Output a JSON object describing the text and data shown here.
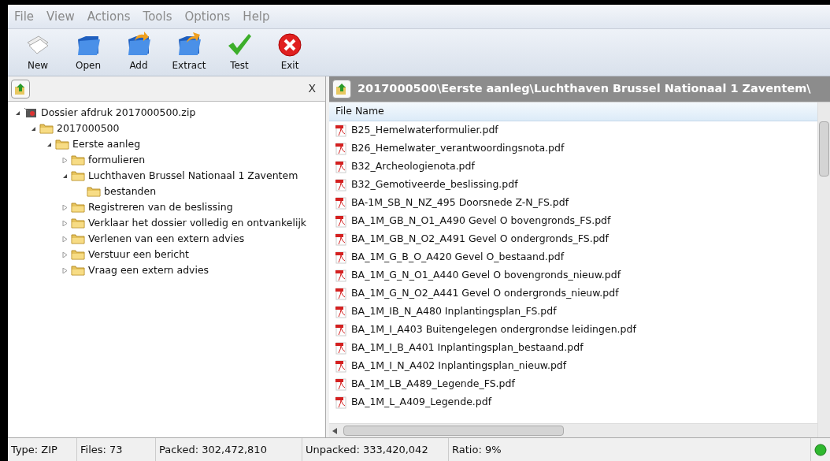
{
  "menu": [
    "File",
    "View",
    "Actions",
    "Tools",
    "Options",
    "Help"
  ],
  "toolbar": [
    {
      "kind": "new",
      "label": "New"
    },
    {
      "kind": "open",
      "label": "Open"
    },
    {
      "kind": "add",
      "label": "Add"
    },
    {
      "kind": "extract",
      "label": "Extract"
    },
    {
      "kind": "test",
      "label": "Test"
    },
    {
      "kind": "exit",
      "label": "Exit"
    }
  ],
  "left_pane": {
    "close": "X",
    "tree": [
      {
        "label": "Dossier afdruk 2017000500.zip",
        "kind": "archive",
        "expanded": true,
        "children": [
          {
            "label": "2017000500",
            "kind": "folder",
            "expanded": true,
            "children": [
              {
                "label": "Eerste aanleg",
                "kind": "folder",
                "expanded": true,
                "children": [
                  {
                    "label": "formulieren",
                    "kind": "folder",
                    "expanded": false
                  },
                  {
                    "label": "Luchthaven Brussel Nationaal 1 Zaventem",
                    "kind": "folder",
                    "expanded": true,
                    "children": [
                      {
                        "label": "bestanden",
                        "kind": "folder"
                      }
                    ]
                  },
                  {
                    "label": "Registreren van de beslissing",
                    "kind": "folder",
                    "expanded": false
                  },
                  {
                    "label": "Verklaar het dossier volledig en ontvankelijk",
                    "kind": "folder",
                    "expanded": false
                  },
                  {
                    "label": "Verlenen van een extern advies",
                    "kind": "folder",
                    "expanded": false
                  },
                  {
                    "label": "Verstuur een bericht",
                    "kind": "folder",
                    "expanded": false
                  },
                  {
                    "label": "Vraag een extern advies",
                    "kind": "folder",
                    "expanded": false
                  }
                ]
              }
            ]
          }
        ]
      }
    ]
  },
  "right_pane": {
    "path": "2017000500\\Eerste aanleg\\Luchthaven Brussel Nationaal 1 Zaventem\\",
    "column": "File Name",
    "files": [
      "B25_Hemelwaterformulier.pdf",
      "B26_Hemelwater_verantwoordingsnota.pdf",
      "B32_Archeologienota.pdf",
      "B32_Gemotiveerde_beslissing.pdf",
      "BA-1M_SB_N_NZ_495 Doorsnede Z-N_FS.pdf",
      "BA_1M_GB_N_O1_A490 Gevel O bovengronds_FS.pdf",
      "BA_1M_GB_N_O2_A491 Gevel O ondergronds_FS.pdf",
      "BA_1M_G_B_O_A420 Gevel O_bestaand.pdf",
      "BA_1M_G_N_O1_A440 Gevel O bovengronds_nieuw.pdf",
      "BA_1M_G_N_O2_A441 Gevel O ondergronds_nieuw.pdf",
      "BA_1M_IB_N_A480 Inplantingsplan_FS.pdf",
      "BA_1M_I_A403 Buitengelegen ondergrondse leidingen.pdf",
      "BA_1M_I_B_A401 Inplantingsplan_bestaand.pdf",
      "BA_1M_I_N_A402 Inplantingsplan_nieuw.pdf",
      "BA_1M_LB_A489_Legende_FS.pdf",
      "BA_1M_L_A409_Legende.pdf"
    ]
  },
  "status_bar": [
    "Type: ZIP",
    "Files: 73",
    "Packed: 302,472,810",
    "Unpacked: 333,420,042",
    "Ratio: 9%"
  ]
}
